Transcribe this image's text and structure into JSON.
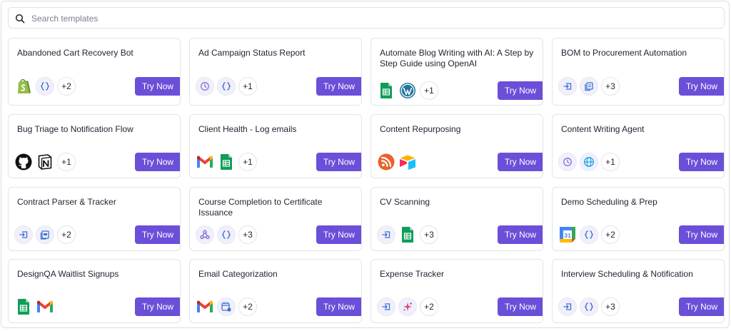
{
  "search": {
    "placeholder": "Search templates",
    "value": ""
  },
  "colors": {
    "accent": "#6b4fd8",
    "border": "#e3e4e9",
    "text": "#1f2330"
  },
  "try_label": "Try Now",
  "templates": [
    {
      "title": "Abandoned Cart Recovery Bot",
      "apps": [
        "shopify-icon",
        "code-block-icon"
      ],
      "more": "+2"
    },
    {
      "title": "Ad Campaign Status Report",
      "apps": [
        "clock-icon",
        "code-block-icon"
      ],
      "more": "+1"
    },
    {
      "title": "Automate Blog Writing with AI: A Step by Step Guide using OpenAI",
      "apps": [
        "google-sheets-icon",
        "wordpress-icon"
      ],
      "more": "+1"
    },
    {
      "title": "BOM to Procurement Automation",
      "apps": [
        "input-box-icon",
        "document-icon"
      ],
      "more": "+3"
    },
    {
      "title": "Bug Triage to Notification Flow",
      "apps": [
        "github-icon",
        "notion-icon"
      ],
      "more": "+1"
    },
    {
      "title": "Client Health - Log emails",
      "apps": [
        "gmail-icon",
        "google-sheets-icon"
      ],
      "more": "+1"
    },
    {
      "title": "Content Repurposing",
      "apps": [
        "rss-icon",
        "airtable-icon"
      ],
      "more": ""
    },
    {
      "title": "Content Writing Agent",
      "apps": [
        "clock-icon",
        "globe-icon"
      ],
      "more": "+1"
    },
    {
      "title": "Contract Parser & Tracker",
      "apps": [
        "input-box-icon",
        "pdf-doc-icon"
      ],
      "more": "+2"
    },
    {
      "title": "Course Completion to Certificate Issuance",
      "apps": [
        "webhook-icon",
        "code-block-icon"
      ],
      "more": "+3"
    },
    {
      "title": "CV Scanning",
      "apps": [
        "input-box-icon",
        "google-sheets-icon"
      ],
      "more": "+3"
    },
    {
      "title": "Demo Scheduling & Prep",
      "apps": [
        "google-calendar-icon",
        "code-block-icon"
      ],
      "more": "+2"
    },
    {
      "title": "DesignQA Waitlist Signups",
      "apps": [
        "google-sheets-icon",
        "gmail-icon"
      ],
      "more": ""
    },
    {
      "title": "Email Categorization",
      "apps": [
        "gmail-icon",
        "calendar-gear-icon"
      ],
      "more": "+2"
    },
    {
      "title": "Expense Tracker",
      "apps": [
        "input-box-icon",
        "ai-sparkle-icon"
      ],
      "more": "+2"
    },
    {
      "title": "Interview Scheduling & Notification",
      "apps": [
        "input-box-icon",
        "code-block-icon"
      ],
      "more": "+3"
    }
  ]
}
